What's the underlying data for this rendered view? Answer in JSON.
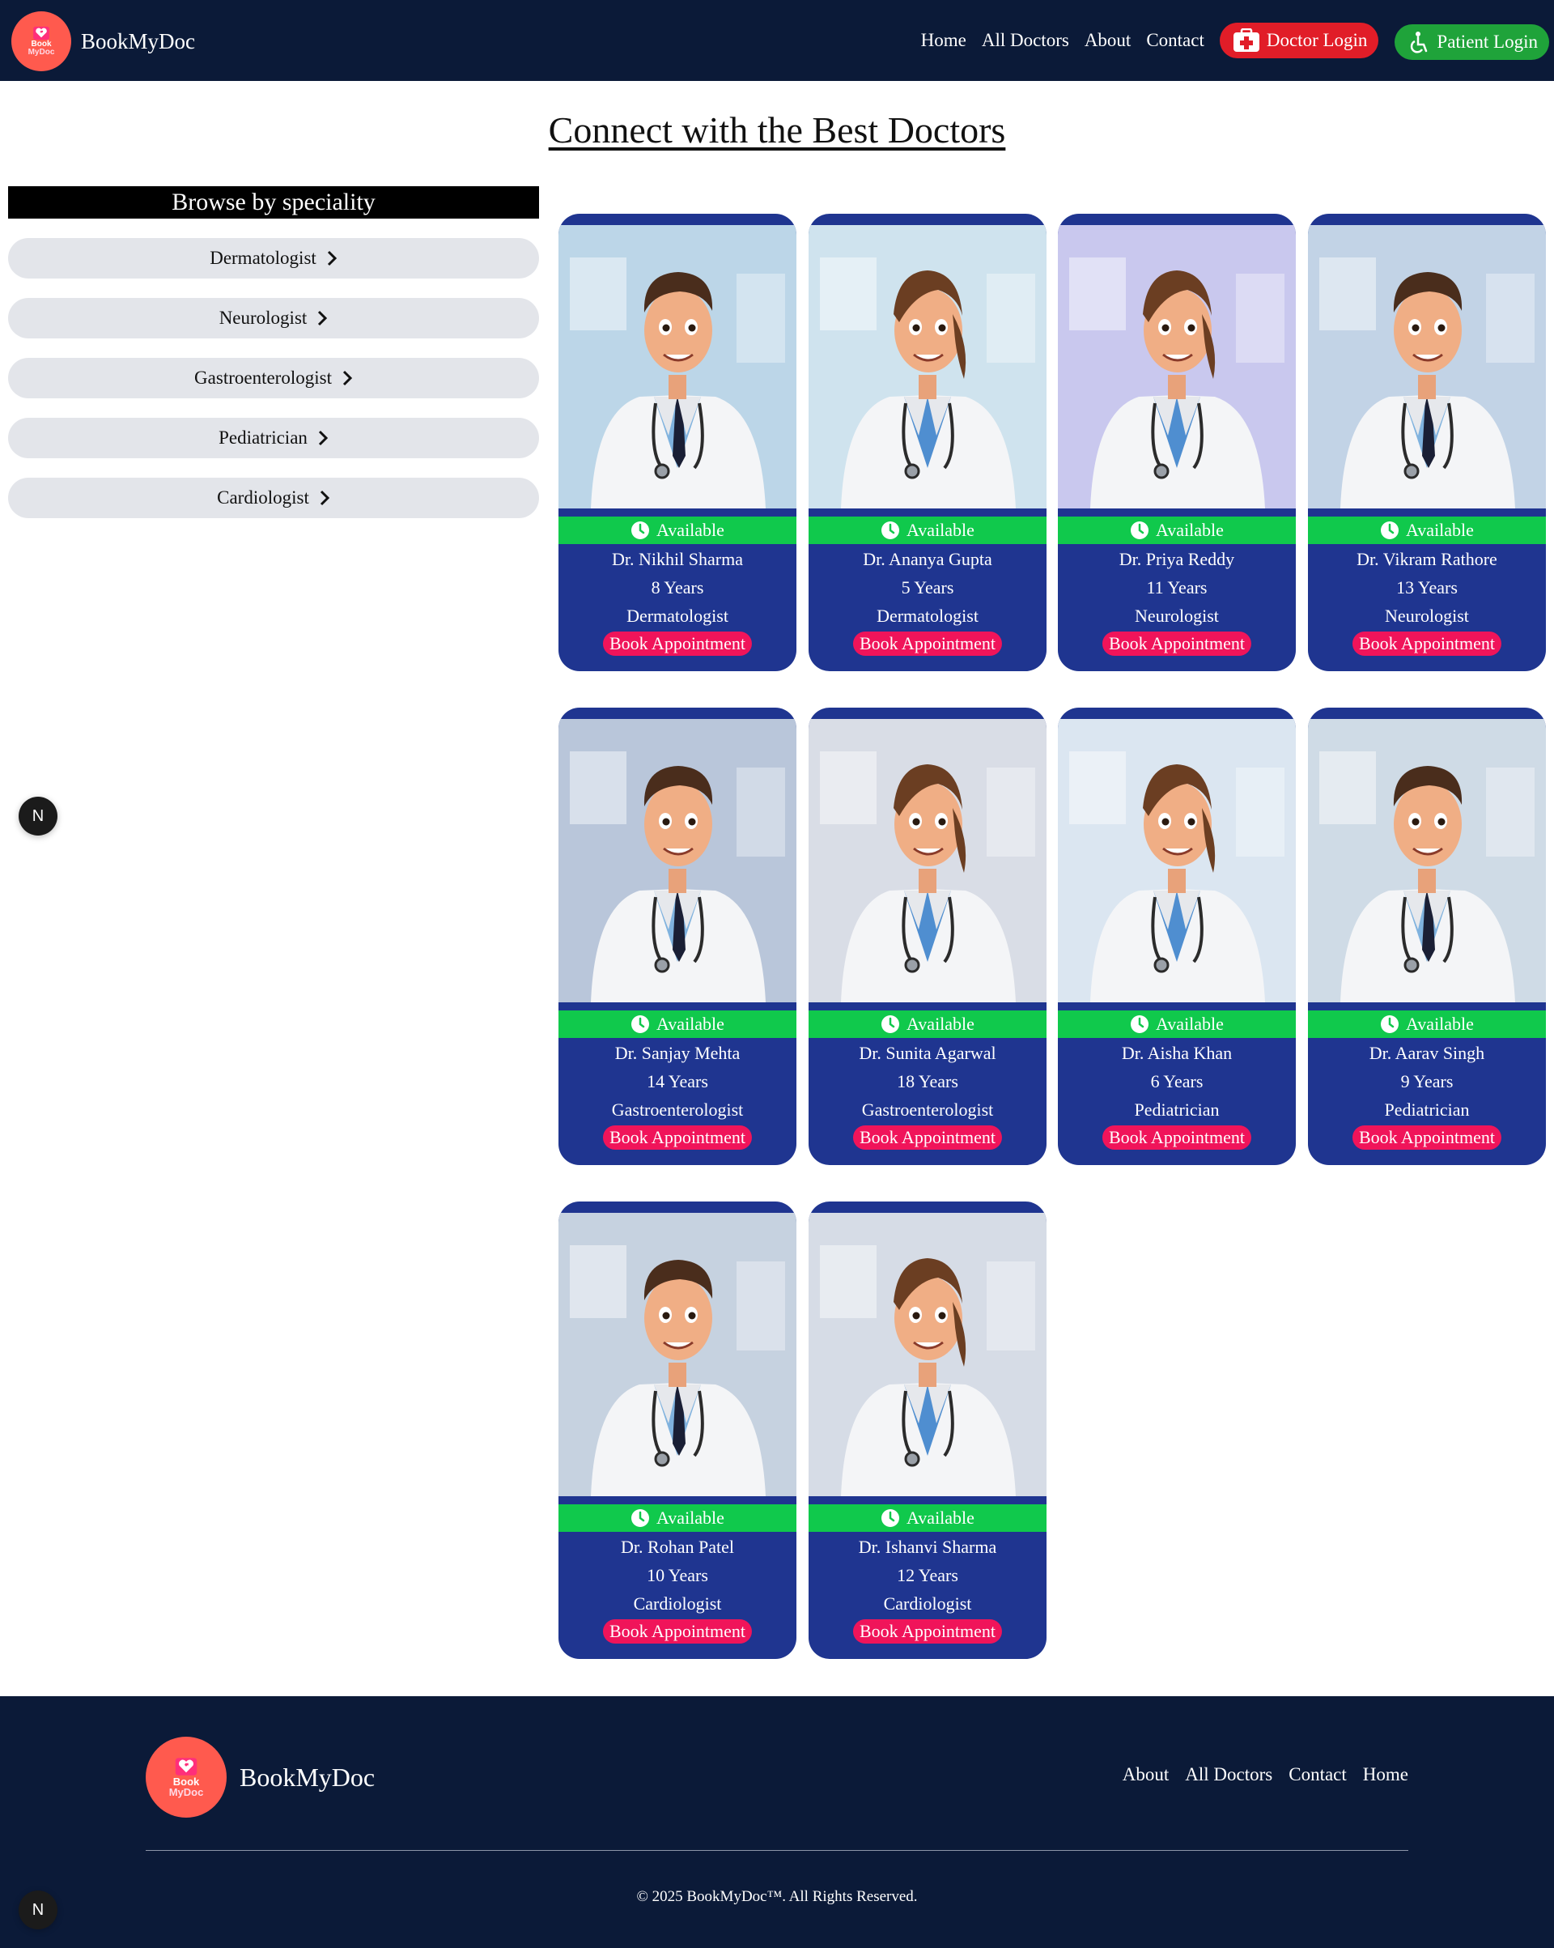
{
  "navbar": {
    "brand_name": "BookMyDoc",
    "logo_line1": "Book",
    "logo_line2": "MyDoc",
    "links": [
      "Home",
      "All Doctors",
      "About",
      "Contact"
    ],
    "doctor_login": "Doctor Login",
    "patient_login": "Patient Login"
  },
  "main": {
    "title": "Connect with the Best Doctors"
  },
  "sidebar": {
    "title": "Browse by speciality",
    "items": [
      "Dermatologist",
      "Neurologist",
      "Gastroenterologist",
      "Pediatrician",
      "Cardiologist"
    ]
  },
  "doctors": [
    {
      "name": "Dr. Nikhil Sharma",
      "years": "8 Years",
      "speciality": "Dermatologist",
      "gender": "male"
    },
    {
      "name": "Dr. Ananya Gupta",
      "years": "5 Years",
      "speciality": "Dermatologist",
      "gender": "female"
    },
    {
      "name": "Dr. Priya Reddy",
      "years": "11 Years",
      "speciality": "Neurologist",
      "gender": "female"
    },
    {
      "name": "Dr. Vikram Rathore",
      "years": "13 Years",
      "speciality": "Neurologist",
      "gender": "male"
    },
    {
      "name": "Dr. Sanjay Mehta",
      "years": "14 Years",
      "speciality": "Gastroenterologist",
      "gender": "male"
    },
    {
      "name": "Dr. Sunita Agarwal",
      "years": "18 Years",
      "speciality": "Gastroenterologist",
      "gender": "female"
    },
    {
      "name": "Dr. Aisha Khan",
      "years": "6 Years",
      "speciality": "Pediatrician",
      "gender": "female"
    },
    {
      "name": "Dr. Aarav Singh",
      "years": "9 Years",
      "speciality": "Pediatrician",
      "gender": "male"
    },
    {
      "name": "Dr. Rohan Patel",
      "years": "10 Years",
      "speciality": "Cardiologist",
      "gender": "male"
    },
    {
      "name": "Dr. Ishanvi Sharma",
      "years": "12 Years",
      "speciality": "Cardiologist",
      "gender": "female"
    }
  ],
  "card_labels": {
    "available": "Available",
    "book": "Book Appointment"
  },
  "badge": {
    "letter": "N"
  },
  "footer": {
    "brand_name": "BookMyDoc",
    "links": [
      "About",
      "All Doctors",
      "Contact",
      "Home"
    ],
    "copyright": "© 2025 BookMyDoc™. All Rights Reserved."
  },
  "colors": {
    "navbar_bg": "#0b1a38",
    "card_bg": "#1f3590",
    "available_green": "#10c94c",
    "book_pink": "#f0145a",
    "doctor_login_red": "#e11d28",
    "patient_login_green": "#1fa33a",
    "logo_coral": "#ff5a4e"
  },
  "icons": [
    "heart-plus-logo-icon",
    "first-aid-icon",
    "accessibility-icon",
    "chevron-right-icon",
    "clock-icon"
  ]
}
